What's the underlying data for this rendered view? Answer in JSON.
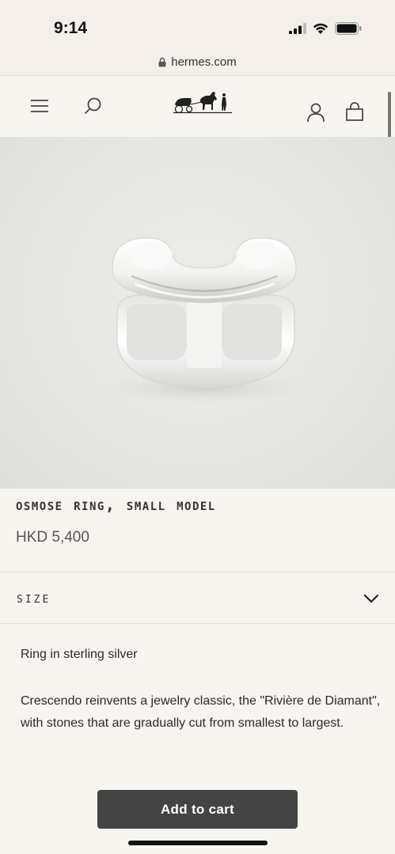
{
  "status_bar": {
    "time": "9:14",
    "icons": [
      "cellular-signal-icon",
      "wifi-icon",
      "battery-icon"
    ]
  },
  "browser": {
    "url": "hermes.com",
    "lock_icon": "lock-icon"
  },
  "header": {
    "menu_icon": "hamburger-menu-icon",
    "search_icon": "search-icon",
    "logo": "hermes-carriage-logo",
    "account_icon": "account-icon",
    "bag_icon": "shopping-bag-icon"
  },
  "product": {
    "image": "silver-ring-image",
    "title": "Osmose ring, small model",
    "price": "HKD 5,400"
  },
  "size": {
    "label": "Size",
    "chevron": "chevron-down-icon"
  },
  "description": {
    "short": "Ring in sterling silver",
    "long": "Crescendo reinvents a jewelry classic, the \"Rivière de Diamant\", with stones that are gradually cut from smallest to largest."
  },
  "cart": {
    "label": "Add to cart"
  },
  "colors": {
    "background": "#f8f5f0",
    "button": "#444444",
    "button_text": "#ffffff"
  }
}
